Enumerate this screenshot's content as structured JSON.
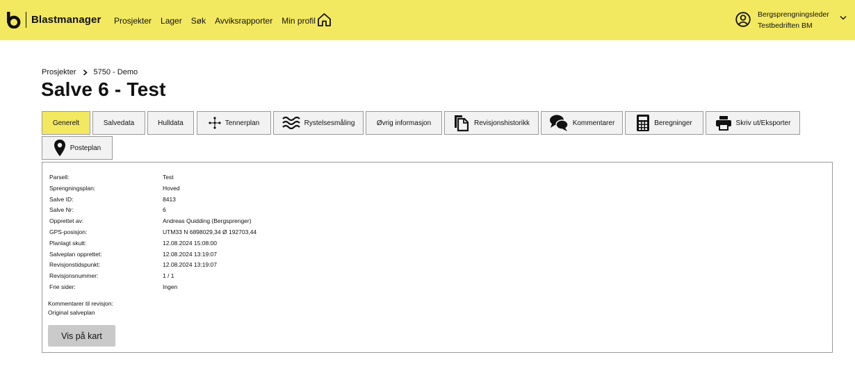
{
  "header": {
    "brand": "Blastmanager",
    "nav": [
      "Prosjekter",
      "Lager",
      "Søk",
      "Avviksrapporter",
      "Min profil"
    ],
    "user_role": "Bergsprengningsleder",
    "user_company": "Testbedriften BM",
    "icons": {
      "logo": "blastmanager-logo",
      "home": "home-icon",
      "user": "user-circle-icon",
      "chevron": "chevron-down-icon"
    },
    "background_color": "#f3e961"
  },
  "breadcrumb": [
    "Prosjekter",
    "5750 - Demo"
  ],
  "title": "Salve 6 - Test",
  "tabs": [
    {
      "label": "Generelt",
      "active": true
    },
    {
      "label": "Salvedata"
    },
    {
      "label": "Hulldata"
    },
    {
      "label": "Tennerplan",
      "icon": "network-icon"
    },
    {
      "label": "Rystelsesmåling",
      "icon": "waves-icon"
    },
    {
      "label": "Øvrig informasjon"
    },
    {
      "label": "Revisjonshistorikk",
      "icon": "documents-icon"
    },
    {
      "label": "Kommentarer",
      "icon": "chat-bubbles-icon"
    },
    {
      "label": "Beregninger",
      "icon": "calculator-icon"
    },
    {
      "label": "Skriv ut/Eksporter",
      "icon": "printer-icon"
    },
    {
      "label": "Posteplan",
      "icon": "map-pin-icon"
    }
  ],
  "details": [
    {
      "label": "Parsell:",
      "value": "Test"
    },
    {
      "label": "Sprengningsplan:",
      "value": "Hoved"
    },
    {
      "label": "Salve ID:",
      "value": "8413"
    },
    {
      "label": "Salve Nr:",
      "value": "6"
    },
    {
      "label": "Opprettet av:",
      "value": "Andreas Quidding (Bergsprenger)"
    },
    {
      "label": "GPS-posisjon:",
      "value": "UTM33 N 6898029,34 Ø 192703,44"
    },
    {
      "label": "Planlagt skutt:",
      "value": "12.08.2024 15:08:00"
    },
    {
      "label": "Salveplan opprettet:",
      "value": "12.08.2024 13:19:07"
    },
    {
      "label": "Revisjonstidspunkt:",
      "value": "12.08.2024 13:19:07"
    },
    {
      "label": "Revisjonsnummer:",
      "value": "1 / 1"
    },
    {
      "label": "Frie sider:",
      "value": "Ingen"
    }
  ],
  "comment": {
    "label": "Kommentarer til revisjon:",
    "value": "Original salveplan"
  },
  "map_button": "Vis på kart"
}
